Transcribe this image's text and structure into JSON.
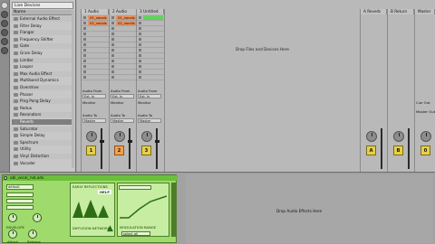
{
  "browser": {
    "search_value": "Live Devices",
    "header": "Name",
    "items": [
      {
        "label": "External Audio Effect"
      },
      {
        "label": "Filter Delay"
      },
      {
        "label": "Flanger"
      },
      {
        "label": "Frequency Shifter"
      },
      {
        "label": "Gate"
      },
      {
        "label": "Grain Delay"
      },
      {
        "label": "Limiter"
      },
      {
        "label": "Looper"
      },
      {
        "label": "Max Audio Effect"
      },
      {
        "label": "Multiband Dynamics"
      },
      {
        "label": "Overdrive"
      },
      {
        "label": "Phaser"
      },
      {
        "label": "Ping Pong Delay"
      },
      {
        "label": "Redux"
      },
      {
        "label": "Resonators"
      },
      {
        "label": "Reverb"
      },
      {
        "label": "Saturator"
      },
      {
        "label": "Simple Delay"
      },
      {
        "label": "Spectrum"
      },
      {
        "label": "Utility"
      },
      {
        "label": "Vinyl Distortion"
      },
      {
        "label": "Vocoder"
      }
    ]
  },
  "session": {
    "tracks": [
      {
        "title": "1 Audio",
        "clips": [
          "01_vocals",
          "02_vocals"
        ],
        "clip_color": "#e9905c",
        "number": "1"
      },
      {
        "title": "2 Audio",
        "clips": [
          "01_vocals",
          "02_vocals"
        ],
        "clip_color": "#e9905c",
        "number": "2"
      },
      {
        "title": "3 Untitled",
        "clips": [
          ""
        ],
        "clip_color": "#65d160",
        "number": "3"
      }
    ],
    "returns": [
      {
        "title": "A Reverb",
        "number": "A"
      },
      {
        "title": "B Return",
        "number": "B"
      }
    ],
    "master": {
      "title": "Master",
      "number": "0"
    },
    "drop_hint": "Drop Files and Devices Here",
    "io": {
      "audio_from": "Audio From",
      "monitor": "Monitor",
      "audio_to": "Audio To",
      "in_value": "Ext. In",
      "auto_value": "Auto",
      "master_value": "Master",
      "cue_out": "Cue Out",
      "master_out": "Master Out"
    }
  },
  "device": {
    "title": "abl_vocal_rvb.adv",
    "preset": "default",
    "labels": {
      "early_reflections": "EARLY REFLECTIONS",
      "help": "HELP",
      "modulation": "MODULATION RANGE",
      "diffusion": "DIFFUSION NETWORK",
      "envelope": "ENVELOPE",
      "attack": "Attack",
      "release": "Release",
      "select": "select all"
    },
    "chain_hint": "Drop Audio Effects Here"
  }
}
